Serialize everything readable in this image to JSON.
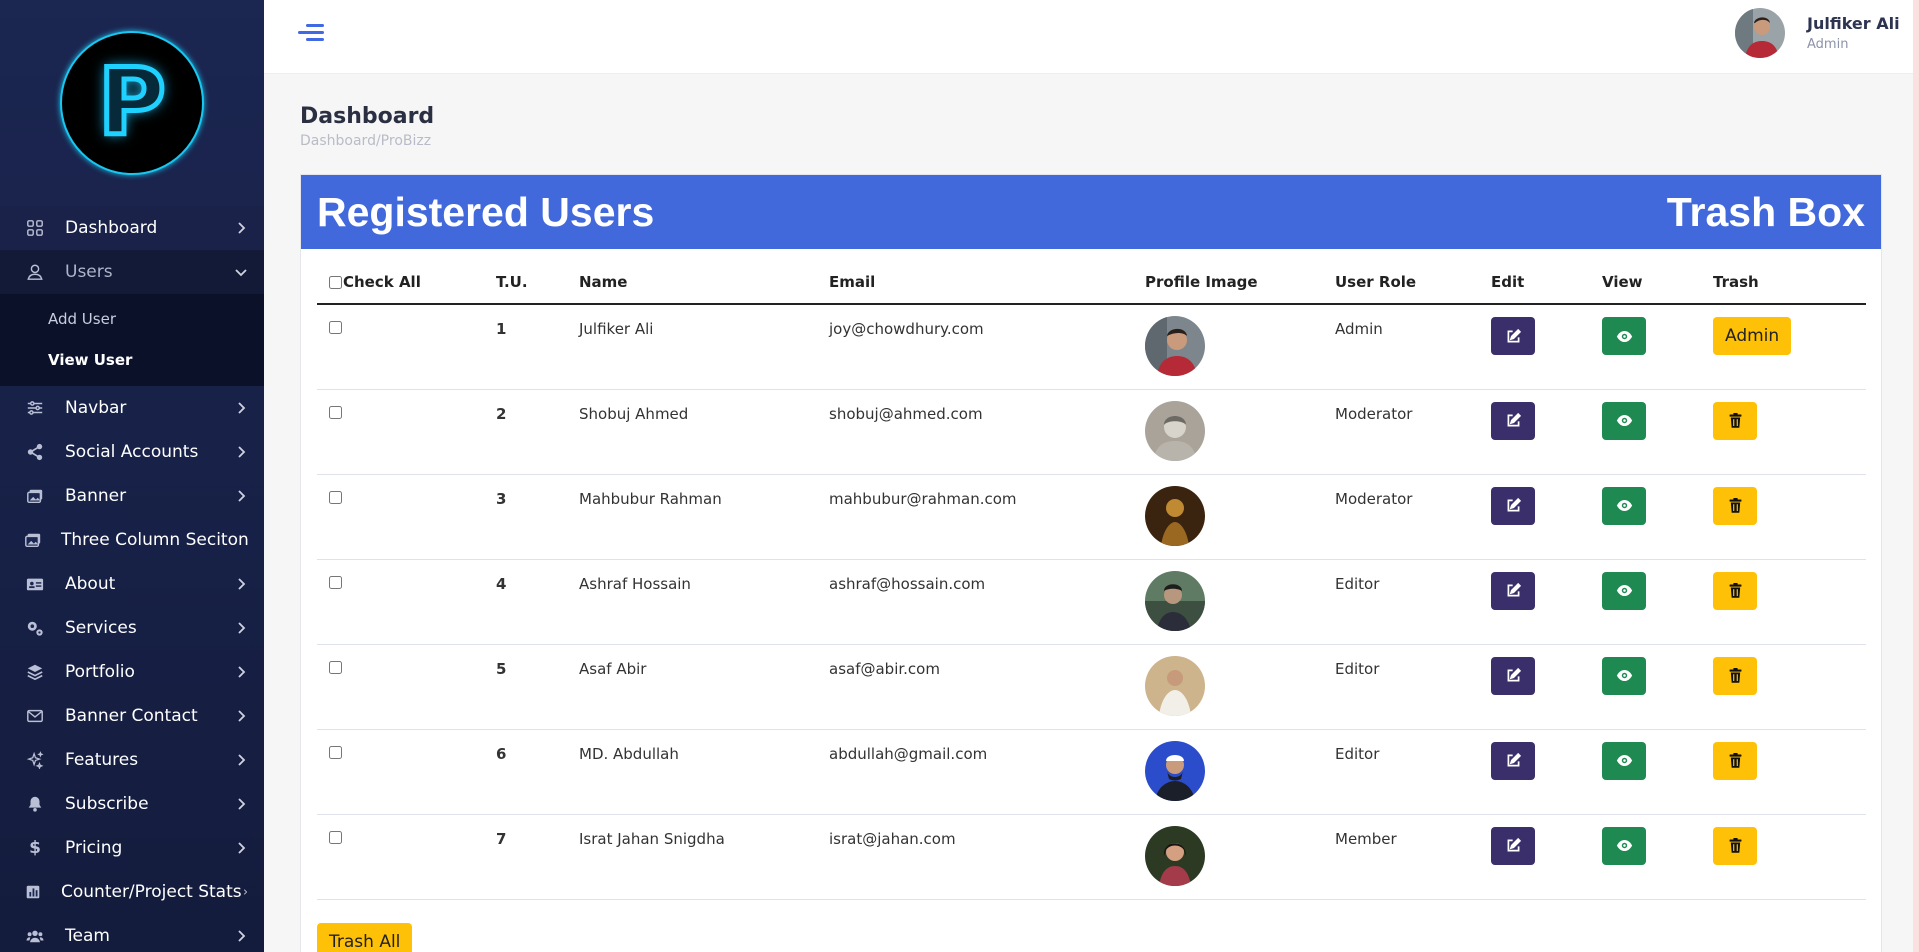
{
  "logo": {
    "letter": "P"
  },
  "sidebar": {
    "items": [
      {
        "label": "Dashboard",
        "icon": "grid-icon"
      },
      {
        "label": "Users",
        "icon": "user-icon"
      },
      {
        "label": "Navbar",
        "icon": "sliders-icon"
      },
      {
        "label": "Social Accounts",
        "icon": "share-icon"
      },
      {
        "label": "Banner",
        "icon": "image-icon"
      },
      {
        "label": "Three Column Seciton",
        "icon": "image-icon"
      },
      {
        "label": "About",
        "icon": "id-card-icon"
      },
      {
        "label": "Services",
        "icon": "gears-icon"
      },
      {
        "label": "Portfolio",
        "icon": "layers-icon"
      },
      {
        "label": "Banner Contact",
        "icon": "envelope-icon"
      },
      {
        "label": "Features",
        "icon": "sparkle-icon"
      },
      {
        "label": "Subscribe",
        "icon": "bell-icon"
      },
      {
        "label": "Pricing",
        "icon": "dollar-icon"
      },
      {
        "label": "Counter/Project Stats",
        "icon": "chart-icon"
      },
      {
        "label": "Team",
        "icon": "users-icon"
      }
    ],
    "users_sub": [
      {
        "label": "Add User"
      },
      {
        "label": "View User"
      }
    ]
  },
  "topbar": {
    "user_name": "Julfiker Ali",
    "user_role": "Admin"
  },
  "page": {
    "title": "Dashboard",
    "breadcrumb": "Dashboard/ProBizz"
  },
  "card": {
    "title": "Registered Users",
    "trash_box": "Trash Box",
    "trash_all": "Trash All"
  },
  "table": {
    "headers": {
      "check_all": "Check All",
      "tu": "T.U.",
      "name": "Name",
      "email": "Email",
      "profile_image": "Profile Image",
      "user_role": "User Role",
      "edit": "Edit",
      "view": "View",
      "trash": "Trash"
    },
    "rows": [
      {
        "tu": "1",
        "name": "Julfiker Ali",
        "email": "joy@chowdhury.com",
        "role": "Admin",
        "trash_label": "Admin"
      },
      {
        "tu": "2",
        "name": "Shobuj Ahmed",
        "email": "shobuj@ahmed.com",
        "role": "Moderator"
      },
      {
        "tu": "3",
        "name": "Mahbubur Rahman",
        "email": "mahbubur@rahman.com",
        "role": "Moderator"
      },
      {
        "tu": "4",
        "name": "Ashraf Hossain",
        "email": "ashraf@hossain.com",
        "role": "Editor"
      },
      {
        "tu": "5",
        "name": "Asaf Abir",
        "email": "asaf@abir.com",
        "role": "Editor"
      },
      {
        "tu": "6",
        "name": "MD. Abdullah",
        "email": "abdullah@gmail.com",
        "role": "Editor"
      },
      {
        "tu": "7",
        "name": "Israt Jahan Snigdha",
        "email": "israt@jahan.com",
        "role": "Member"
      }
    ]
  },
  "colors": {
    "sidebar_bg": "#1b2651",
    "accent": "#4169dc",
    "edit_btn": "#3a2f6b",
    "view_btn": "#1e8a52",
    "trash_btn": "#fec107"
  }
}
